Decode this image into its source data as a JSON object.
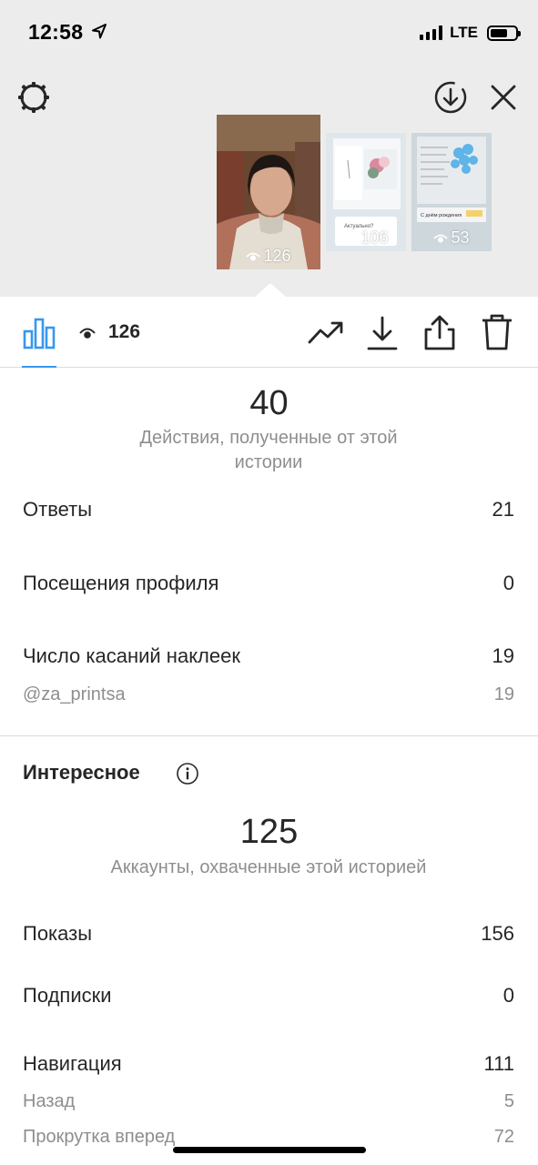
{
  "status_bar": {
    "time": "12:58",
    "network": "LTE"
  },
  "stories": [
    {
      "views": "126"
    },
    {
      "views": "106",
      "card_text": "Актуально?"
    },
    {
      "views": "53",
      "card_text": "С днём рождения"
    }
  ],
  "toolbar": {
    "views_count": "126"
  },
  "interactions": {
    "total": "40",
    "caption": "Действия, полученные от этой истории",
    "rows": [
      {
        "label": "Ответы",
        "value": "21"
      },
      {
        "label": "Посещения профиля",
        "value": "0"
      },
      {
        "label": "Число касаний наклеек",
        "value": "19"
      }
    ],
    "sticker": {
      "label": "@za_printsa",
      "value": "19"
    }
  },
  "discovery": {
    "title": "Интересное",
    "total": "125",
    "caption": "Аккаунты, охваченные этой историей",
    "rows": [
      {
        "label": "Показы",
        "value": "156"
      },
      {
        "label": "Подписки",
        "value": "0"
      },
      {
        "label": "Навигация",
        "value": "111"
      }
    ],
    "navigation_sub": [
      {
        "label": "Назад",
        "value": "5"
      },
      {
        "label": "Прокрутка вперед",
        "value": "72"
      }
    ]
  },
  "colors": {
    "accent": "#3897f0",
    "muted": "#8e8e8e",
    "text": "#262626",
    "top_bg": "#ececec"
  }
}
